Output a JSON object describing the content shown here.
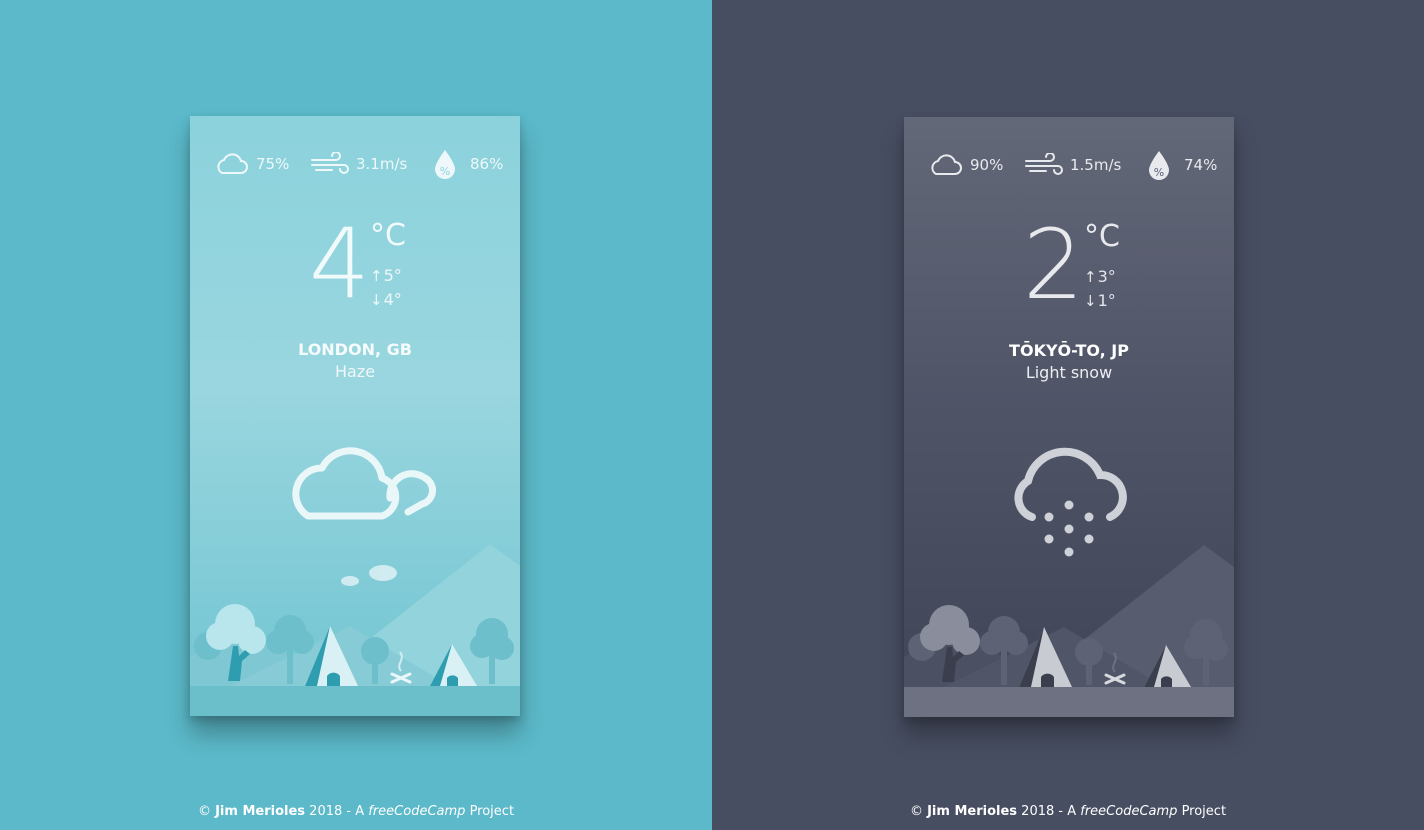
{
  "cards": [
    {
      "theme": "day",
      "clouds": "75%",
      "wind": "3.1m/s",
      "humidity": "86%",
      "temperature": "4",
      "unit": "°C",
      "high": "5°",
      "low": "4°",
      "location": "LONDON, GB",
      "condition": "Haze",
      "condition_icon": "cloudy-icon"
    },
    {
      "theme": "night",
      "clouds": "90%",
      "wind": "1.5m/s",
      "humidity": "74%",
      "temperature": "2",
      "unit": "°C",
      "high": "3°",
      "low": "1°",
      "location": "TŌKYŌ-TO, JP",
      "condition": "Light snow",
      "condition_icon": "snow-night-icon"
    }
  ],
  "footer": {
    "copyright": "©",
    "author": "Jim Merioles",
    "year_text": "2018 - A",
    "brand": "freeCodeCamp",
    "suffix": "Project"
  },
  "colors": {
    "day_background": "#5bb9c9",
    "night_background": "#484e62"
  },
  "icons": {
    "arrow_up": "↑",
    "arrow_down": "↓"
  }
}
